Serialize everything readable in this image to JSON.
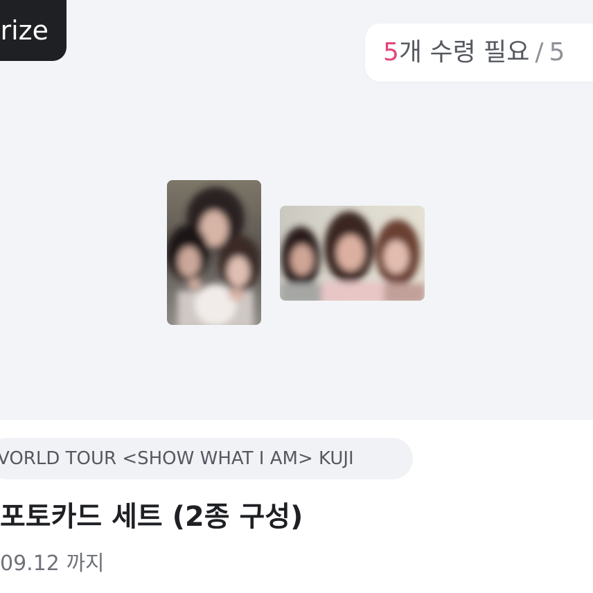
{
  "badge": {
    "label": "rize"
  },
  "requirement": {
    "count": "5",
    "unit_text": "개 수령 필요",
    "separator": "/",
    "total": "5"
  },
  "photos": [
    {
      "name": "photocard-portrait"
    },
    {
      "name": "photocard-landscape"
    }
  ],
  "tag": {
    "text": "VORLD TOUR <SHOW WHAT I AM> KUJI"
  },
  "title": {
    "text": "포토카드 세트 (2종 구성)"
  },
  "deadline": {
    "date": "09.12",
    "suffix": "까지"
  },
  "colors": {
    "accent": "#e4457a",
    "badge_bg": "#1f2024",
    "hero_bg": "#f3f4f7"
  }
}
